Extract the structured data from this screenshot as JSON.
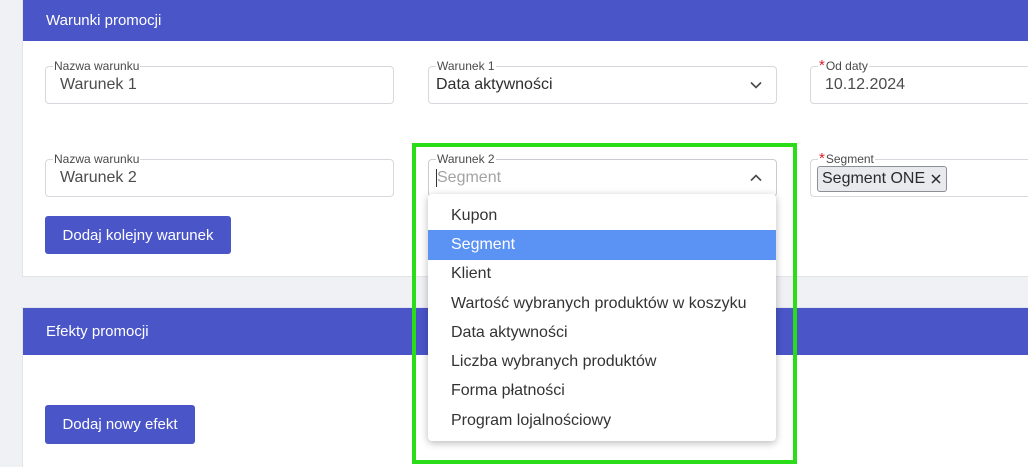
{
  "conditions": {
    "title": "Warunki promocji",
    "row1": {
      "name_label": "Nazwa warunku",
      "name_value": "Warunek 1",
      "condition_label": "Warunek 1",
      "condition_value": "Data aktywności",
      "date_label": "Od daty",
      "date_value": "10.12.2024"
    },
    "row2": {
      "name_label": "Nazwa warunku",
      "name_value": "Warunek 2",
      "condition_label": "Warunek 2",
      "condition_placeholder": "Segment",
      "segment_label": "Segment",
      "segment_chip": "Segment ONE"
    },
    "add_button": "Dodaj kolejny warunek"
  },
  "effects": {
    "title": "Efekty promocji",
    "add_button": "Dodaj nowy efekt"
  },
  "dropdown": {
    "options": [
      "Kupon",
      "Segment",
      "Klient",
      "Wartość wybranych produktów w koszyku",
      "Data aktywności",
      "Liczba wybranych produktów",
      "Forma płatności",
      "Program lojalnościowy"
    ],
    "highlighted": "Segment"
  },
  "colors": {
    "header": "#4a55c8",
    "option_highlight": "#5b93f5",
    "annotation_box": "#2bdc18",
    "required": "#d8202a"
  }
}
